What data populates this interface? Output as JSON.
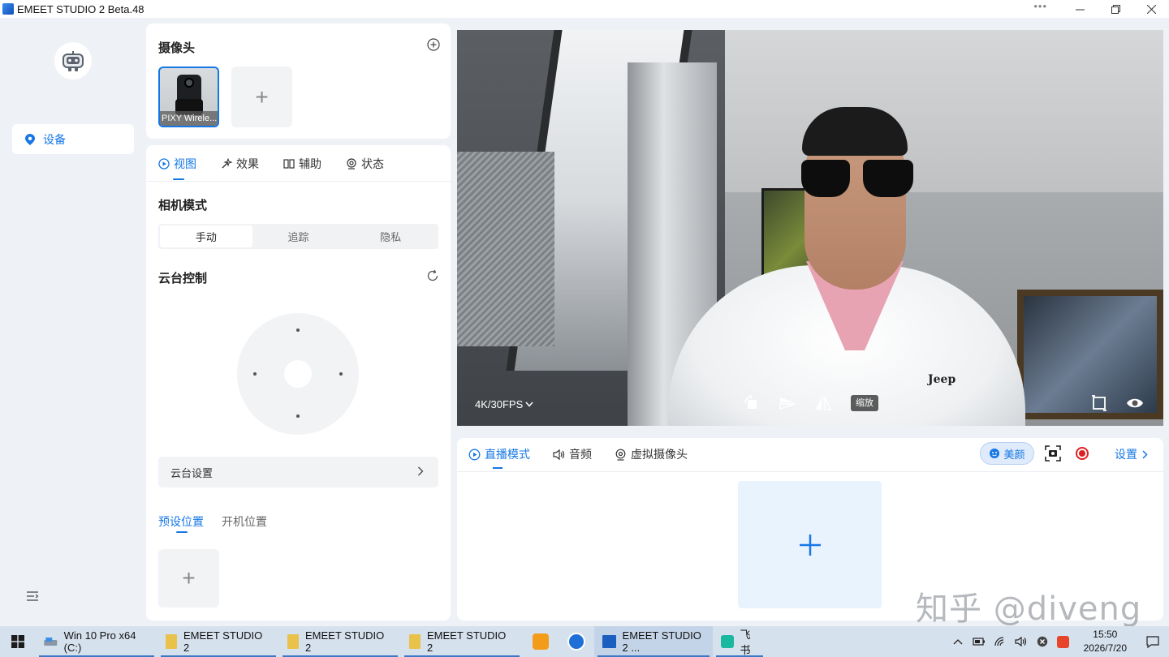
{
  "window": {
    "title": "EMEET STUDIO 2 Beta.48",
    "controls": {
      "more": "•••",
      "minimize": "—",
      "restore": "❐",
      "close": "✕"
    }
  },
  "sidebar": {
    "items": [
      {
        "label": "设备",
        "icon": "location-pin-icon",
        "active": true
      }
    ],
    "bottom_icon": "menu-list-icon"
  },
  "camera_panel": {
    "title": "摄像头",
    "cameras": [
      {
        "name": "PIXY Wirele..."
      }
    ],
    "add_symbol": "+"
  },
  "control_panel": {
    "tabs": [
      {
        "label": "视图",
        "icon": "play-circle-icon",
        "active": true
      },
      {
        "label": "效果",
        "icon": "magic-wand-icon"
      },
      {
        "label": "辅助",
        "icon": "columns-icon"
      },
      {
        "label": "状态",
        "icon": "target-icon"
      }
    ],
    "camera_mode": {
      "title": "相机模式",
      "options": [
        "手动",
        "追踪",
        "隐私"
      ],
      "selected": "手动"
    },
    "gimbal": {
      "title": "云台控制",
      "settings_label": "云台设置"
    },
    "position_tabs": [
      {
        "label": "预设位置",
        "active": true
      },
      {
        "label": "开机位置"
      }
    ],
    "add_symbol": "+"
  },
  "preview": {
    "resolution": "4K/30FPS",
    "zoom_label": "缩放",
    "shirt_logo": "Jeep"
  },
  "bottom_panel": {
    "tabs": [
      {
        "label": "直播模式",
        "icon": "play-circle-icon",
        "active": true
      },
      {
        "label": "音频",
        "icon": "speaker-icon"
      },
      {
        "label": "虚拟摄像头",
        "icon": "target-icon"
      }
    ],
    "beauty_label": "美颜",
    "settings_label": "设置"
  },
  "watermark": "知乎 @diveng",
  "taskbar": {
    "items": [
      {
        "label": "Win 10 Pro x64 (C:)",
        "icon": "drive-icon"
      },
      {
        "label": "EMEET STUDIO 2",
        "icon": "folder-icon"
      },
      {
        "label": "EMEET STUDIO 2",
        "icon": "folder-icon"
      },
      {
        "label": "EMEET STUDIO 2",
        "icon": "folder-icon"
      },
      {
        "label": "EMEET STUDIO 2 ...",
        "icon": "emeet-app-icon"
      },
      {
        "label": "飞书",
        "icon": "feishu-icon"
      }
    ],
    "clock": {
      "time": "15:50",
      "date": "2026/7/20"
    }
  },
  "colors": {
    "accent": "#1677e5",
    "background": "#eef1f6",
    "panel": "#ffffff",
    "record": "#e02020",
    "taskbar": "#d6e1ee"
  }
}
